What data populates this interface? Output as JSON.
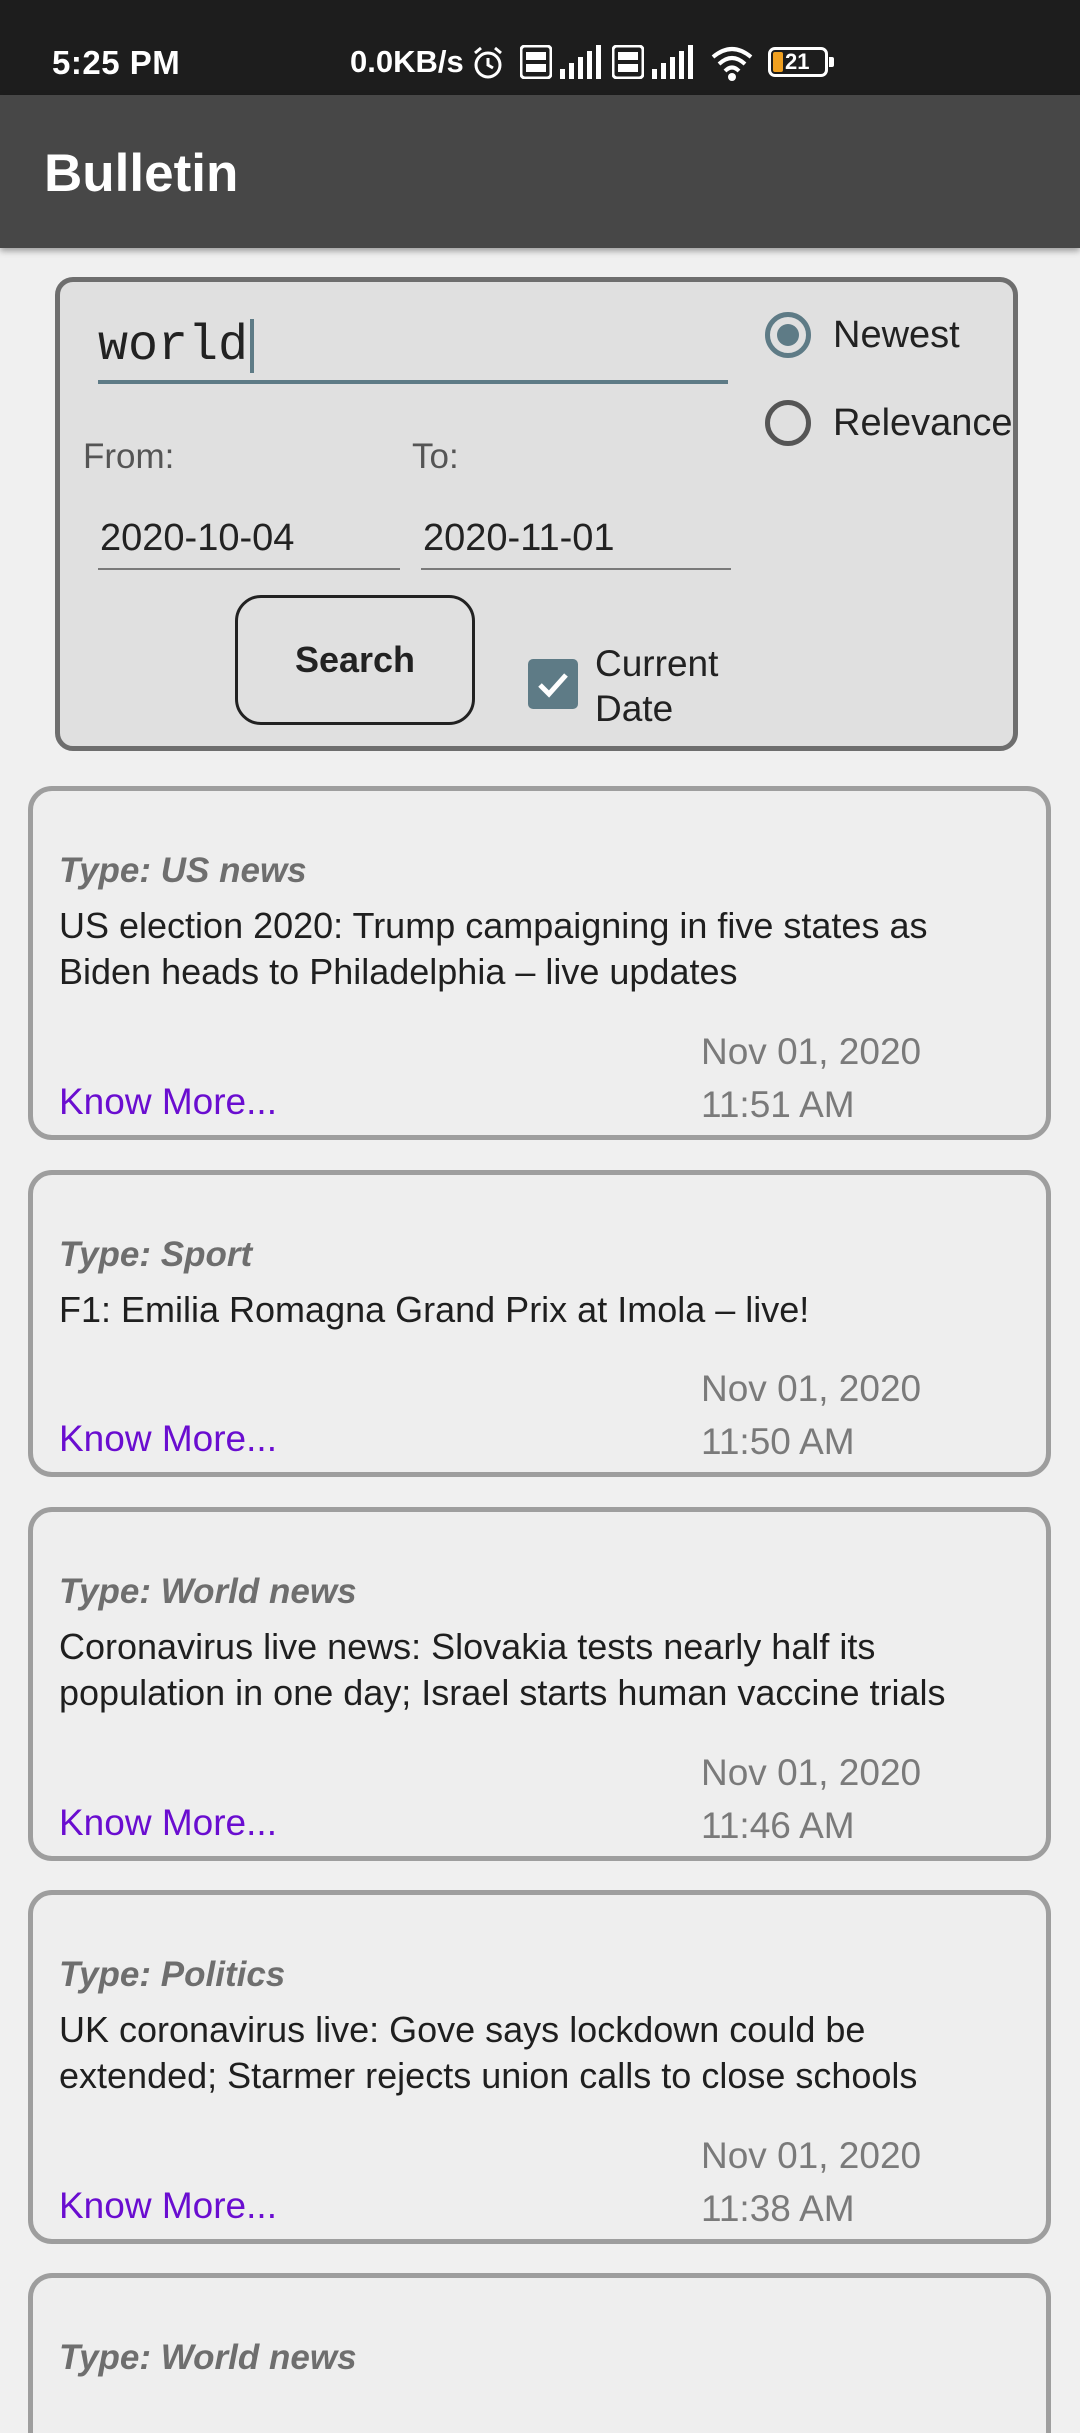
{
  "status_bar": {
    "time": "5:25 PM",
    "network_speed": "0.0KB/s",
    "battery_level": "21",
    "icons": [
      "alarm-icon",
      "volte-icon",
      "signal-icon",
      "volte-icon",
      "signal-icon",
      "wifi-icon",
      "battery-icon"
    ]
  },
  "app_bar": {
    "title": "Bulletin"
  },
  "search": {
    "query": "world",
    "sort_options": {
      "newest_label": "Newest",
      "relevance_label": "Relevance",
      "selected": "Newest"
    },
    "from_label": "From:",
    "to_label": "To:",
    "from_value": "2020-10-04",
    "to_value": "2020-11-01",
    "search_button_label": "Search",
    "current_date_label": "Current Date",
    "current_date_checked": true
  },
  "articles": [
    {
      "type": "Type: US news",
      "title": "US election 2020: Trump campaigning in five states as Biden heads to Philadelphia – live updates",
      "date": "Nov 01, 2020",
      "time": "11:51 AM",
      "link_label": "Know More..."
    },
    {
      "type": "Type: Sport",
      "title": "F1: Emilia Romagna Grand Prix at Imola – live!",
      "date": "Nov 01, 2020",
      "time": "11:50 AM",
      "link_label": "Know More..."
    },
    {
      "type": "Type: World news",
      "title": "Coronavirus live news: Slovakia tests nearly half its population in one day; Israel starts human vaccine trials",
      "date": "Nov 01, 2020",
      "time": "11:46 AM",
      "link_label": "Know More..."
    },
    {
      "type": "Type: Politics",
      "title": "UK coronavirus live: Gove says lockdown could be extended; Starmer rejects union calls to close schools",
      "date": "Nov 01, 2020",
      "time": "11:38 AM",
      "link_label": "Know More..."
    },
    {
      "type": "Type: World news"
    }
  ],
  "colors": {
    "accent": "#5e7b86",
    "link": "#6a0dd0",
    "app_bar": "#474747",
    "status_bar": "#1d1d1d"
  }
}
